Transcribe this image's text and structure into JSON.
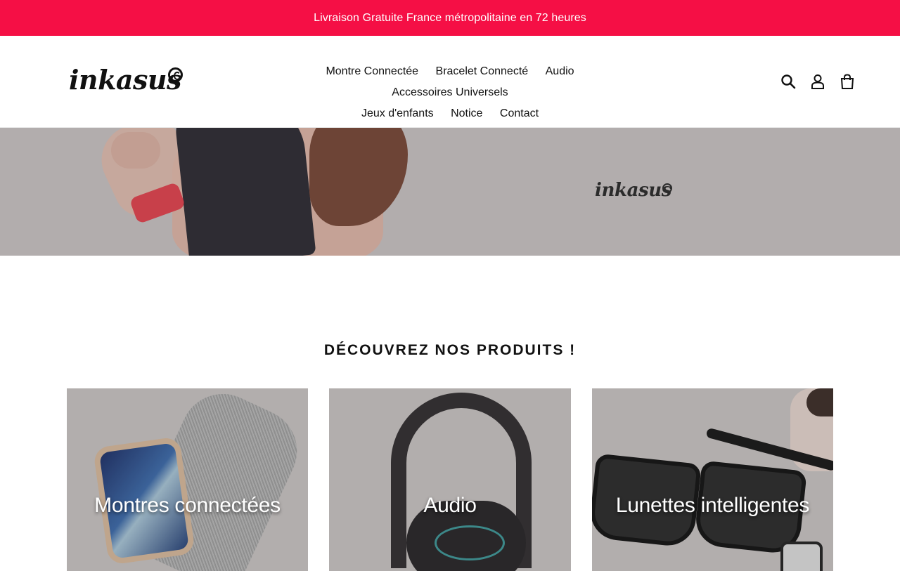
{
  "announcement": {
    "text": "Livraison Gratuite France métropolitaine en 72 heures"
  },
  "header": {
    "logo_text": "inkasus",
    "nav": [
      {
        "label": "Montre Connectée"
      },
      {
        "label": "Bracelet Connecté"
      },
      {
        "label": "Audio"
      },
      {
        "label": "Accessoires Universels"
      },
      {
        "label": "Jeux d'enfants"
      },
      {
        "label": "Notice"
      },
      {
        "label": "Contact"
      }
    ],
    "icons": {
      "search": "search-icon",
      "account": "account-icon",
      "cart": "cart-icon"
    }
  },
  "hero": {
    "logo_text": "inkasus"
  },
  "section": {
    "title": "DÉCOUVREZ NOS PRODUITS !"
  },
  "collections": [
    {
      "label": "Montres connectées"
    },
    {
      "label": "Audio"
    },
    {
      "label": "Lunettes intelligentes"
    }
  ],
  "colors": {
    "announcement_bg": "#f50f45",
    "hero_bg": "#b2adad",
    "card_bg": "#c7c2c1"
  }
}
